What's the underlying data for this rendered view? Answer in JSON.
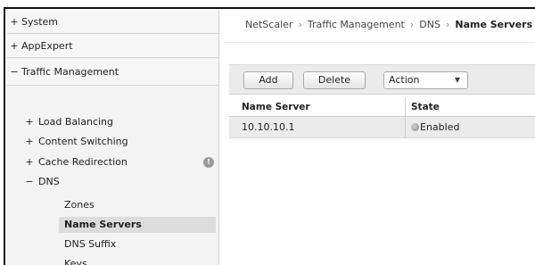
{
  "sidebar": {
    "top_items": [
      {
        "sign": "+",
        "label": "System"
      },
      {
        "sign": "+",
        "label": "AppExpert"
      },
      {
        "sign": "−",
        "label": "Traffic Management"
      }
    ],
    "sub_items": [
      {
        "sign": "+",
        "label": "Load Balancing"
      },
      {
        "sign": "+",
        "label": "Content Switching"
      },
      {
        "sign": "+",
        "label": "Cache Redirection"
      },
      {
        "sign": "−",
        "label": "DNS"
      }
    ],
    "warning_icon": "!",
    "dns_children": [
      "Zones",
      "Name Servers",
      "DNS Suffix",
      "Keys"
    ]
  },
  "breadcrumb": {
    "items": [
      "NetScaler",
      "Traffic Management",
      "DNS"
    ],
    "current": "Name Servers",
    "separator": "›"
  },
  "toolbar": {
    "add_label": "Add",
    "delete_label": "Delete",
    "action_label": "Action",
    "action_caret": "▼"
  },
  "table": {
    "columns": [
      "Name Server",
      "State"
    ],
    "rows": [
      {
        "name": "10.10.10.1",
        "state": "Enabled"
      }
    ]
  }
}
